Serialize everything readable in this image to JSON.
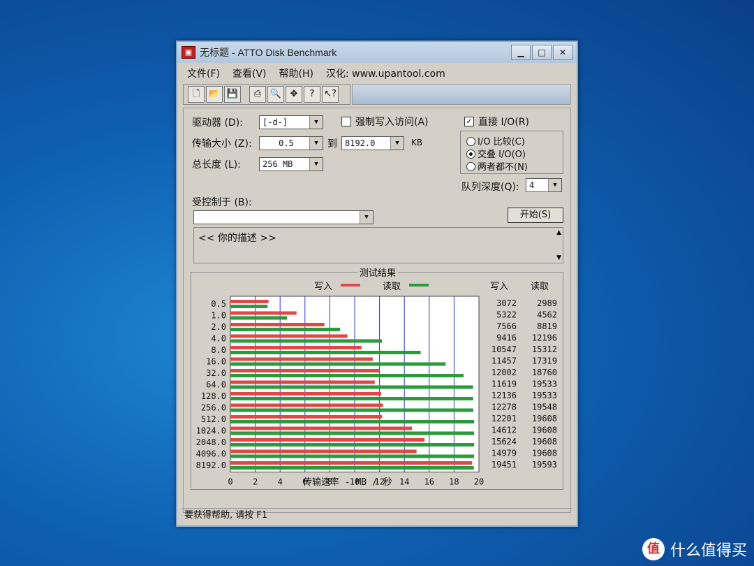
{
  "window": {
    "title": "无标题 - ATTO Disk Benchmark",
    "minimize": "0",
    "maximize": "1",
    "close": "×"
  },
  "menu": {
    "file": "文件(F)",
    "view": "查看(V)",
    "help": "帮助(H)",
    "localized_by": "汉化: www.upantool.com"
  },
  "toolbar": {
    "icons": [
      "new-icon",
      "open-icon",
      "save-icon",
      "print-icon",
      "print-preview-icon",
      "move-icon",
      "help-icon",
      "context-help-icon"
    ]
  },
  "settings": {
    "drive_label": "驱动器 (D):",
    "drive_value": "[-d-]",
    "force_write_label": "强制写入访问(A)",
    "direct_io_label": "直接 I/O(R)",
    "transfer_size_label": "传输大小 (Z):",
    "transfer_from": "0.5",
    "to_label": "到",
    "transfer_to": "8192.0",
    "kb_unit": "KB",
    "total_length_label": "总长度 (L):",
    "total_length_value": "256 MB",
    "io_compare_label": "I/O 比较(C)",
    "overlapped_io_label": "交叠 I/O(O)",
    "neither_label": "两者都不(N)",
    "queue_depth_label": "队列深度(Q):",
    "queue_depth_value": "4",
    "controlled_by_label": "受控制于 (B):",
    "controlled_by_value": "",
    "start_button": "开始(S)",
    "description": "<<  你的描述  >>"
  },
  "results": {
    "title": "测试结果",
    "legend_write": "写入",
    "legend_read": "读取",
    "col_write": "写入",
    "col_read": "读取",
    "write_color": "#e04848",
    "read_color": "#2a9a3a"
  },
  "chart_data": {
    "type": "bar",
    "orientation": "horizontal",
    "categories": [
      "0.5",
      "1.0",
      "2.0",
      "4.0",
      "8.0",
      "16.0",
      "32.0",
      "64.0",
      "128.0",
      "256.0",
      "512.0",
      "1024.0",
      "2048.0",
      "4096.0",
      "8192.0"
    ],
    "series": [
      {
        "name": "写入",
        "values": [
          3072,
          5322,
          7566,
          9416,
          10547,
          11457,
          12002,
          11619,
          12136,
          12278,
          12201,
          14612,
          15624,
          14979,
          19451
        ]
      },
      {
        "name": "读取",
        "values": [
          2989,
          4562,
          8819,
          12196,
          15312,
          17319,
          18760,
          19533,
          19533,
          19548,
          19608,
          19608,
          19608,
          19608,
          19593
        ]
      }
    ],
    "xlabel": "传输速率 - MB / 秒",
    "xticks": [
      "0",
      "2",
      "4",
      "6",
      "8",
      "10",
      "12",
      "14",
      "16",
      "18",
      "20"
    ],
    "xlim": [
      0,
      20
    ],
    "grid": true
  },
  "status": "要获得帮助, 请按 F1",
  "watermark": {
    "logo": "值",
    "text": "什么值得买"
  }
}
